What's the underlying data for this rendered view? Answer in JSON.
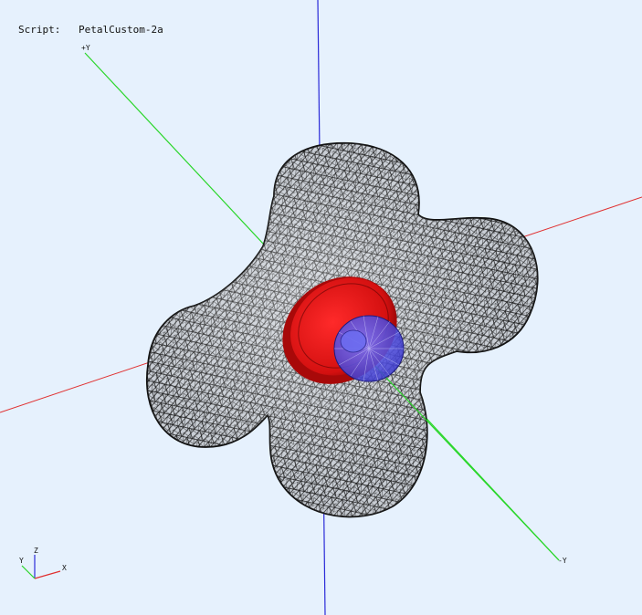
{
  "header": {
    "script_label": "Script:",
    "script_name": "PetalCustom-2a"
  },
  "axes": {
    "plus_y_label": "+Y",
    "minus_y_label": "-Y"
  },
  "triad": {
    "x_label": "X",
    "y_label": "Y",
    "z_label": "Z"
  },
  "colors": {
    "background": "#e6f1fd",
    "x_axis": "#e03030",
    "y_axis": "#29d629",
    "z_axis": "#2a2ad8",
    "mesh_fill": "#c9cfd6",
    "mesh_line": "#111111",
    "red_ring": "#d81414",
    "blue_disc": "#4a48d8"
  }
}
